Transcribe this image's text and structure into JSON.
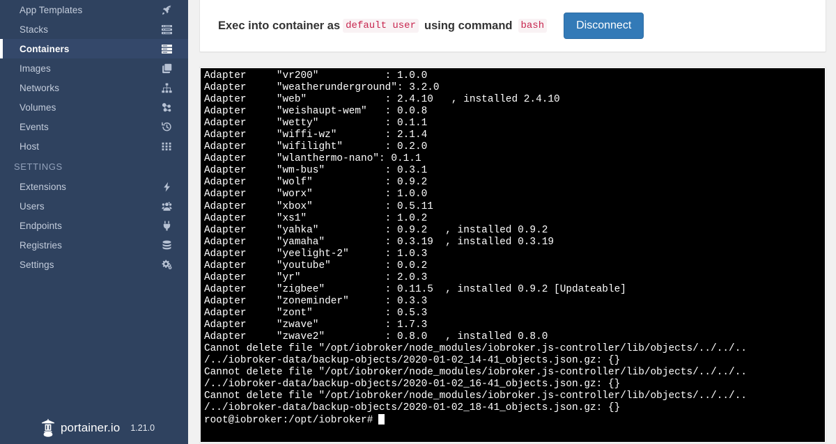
{
  "sidebar": {
    "items": [
      {
        "label": "App Templates",
        "icon": "rocket-icon",
        "active": false,
        "key": "app-templates"
      },
      {
        "label": "Stacks",
        "icon": "stacks-icon",
        "active": false,
        "key": "stacks"
      },
      {
        "label": "Containers",
        "icon": "containers-icon",
        "active": true,
        "key": "containers"
      },
      {
        "label": "Images",
        "icon": "images-icon",
        "active": false,
        "key": "images"
      },
      {
        "label": "Networks",
        "icon": "networks-icon",
        "active": false,
        "key": "networks"
      },
      {
        "label": "Volumes",
        "icon": "volumes-icon",
        "active": false,
        "key": "volumes"
      },
      {
        "label": "Events",
        "icon": "history-icon",
        "active": false,
        "key": "events"
      },
      {
        "label": "Host",
        "icon": "grid-icon",
        "active": false,
        "key": "host"
      }
    ],
    "section_label": "SETTINGS",
    "settings_items": [
      {
        "label": "Extensions",
        "icon": "bolt-icon",
        "active": false,
        "key": "extensions"
      },
      {
        "label": "Users",
        "icon": "users-icon",
        "active": false,
        "key": "users"
      },
      {
        "label": "Endpoints",
        "icon": "plug-icon",
        "active": false,
        "key": "endpoints"
      },
      {
        "label": "Registries",
        "icon": "database-icon",
        "active": false,
        "key": "registries"
      },
      {
        "label": "Settings",
        "icon": "gears-icon",
        "active": false,
        "key": "settings"
      }
    ],
    "footer": {
      "logo": "portainer-lighthouse-logo",
      "brand": "portainer.io",
      "version": "1.21.0"
    },
    "colors": {
      "background": "#2f425f",
      "active_background": "#34486a",
      "accent_bar": "#ffffff"
    }
  },
  "header": {
    "prefix": "Exec into container as",
    "user_code": "default user",
    "middle": "using command",
    "command_code": "bash",
    "disconnect_label": "Disconnect",
    "button_color": "#337ab7",
    "code_color": "#c7254e"
  },
  "terminal": {
    "background": "#000000",
    "foreground": "#ffffff",
    "prompt": "root@iobroker:/opt/iobroker#",
    "lines": [
      "Adapter     \"vr200\"           : 1.0.0",
      "Adapter     \"weatherunderground\": 3.2.0",
      "Adapter     \"web\"             : 2.4.10   , installed 2.4.10",
      "Adapter     \"weishaupt-wem\"   : 0.0.8",
      "Adapter     \"wetty\"           : 0.1.1",
      "Adapter     \"wiffi-wz\"        : 2.1.4",
      "Adapter     \"wifilight\"       : 0.2.0",
      "Adapter     \"wlanthermo-nano\": 0.1.1",
      "Adapter     \"wm-bus\"          : 0.3.1",
      "Adapter     \"wolf\"            : 0.9.2",
      "Adapter     \"worx\"            : 1.0.0",
      "Adapter     \"xbox\"            : 0.5.11",
      "Adapter     \"xs1\"             : 1.0.2",
      "Adapter     \"yahka\"           : 0.9.2   , installed 0.9.2",
      "Adapter     \"yamaha\"          : 0.3.19  , installed 0.3.19",
      "Adapter     \"yeelight-2\"      : 1.0.3",
      "Adapter     \"youtube\"         : 0.0.2",
      "Adapter     \"yr\"              : 2.0.3",
      "Adapter     \"zigbee\"          : 0.11.5  , installed 0.9.2 [Updateable]",
      "Adapter     \"zoneminder\"      : 0.3.3",
      "Adapter     \"zont\"            : 0.5.3",
      "Adapter     \"zwave\"           : 1.7.3",
      "Adapter     \"zwave2\"          : 0.8.0   , installed 0.8.0",
      "Cannot delete file \"/opt/iobroker/node_modules/iobroker.js-controller/lib/objects/../../..",
      "/../iobroker-data/backup-objects/2020-01-02_14-41_objects.json.gz: {}",
      "Cannot delete file \"/opt/iobroker/node_modules/iobroker.js-controller/lib/objects/../../..",
      "/../iobroker-data/backup-objects/2020-01-02_16-41_objects.json.gz: {}",
      "Cannot delete file \"/opt/iobroker/node_modules/iobroker.js-controller/lib/objects/../../..",
      "/../iobroker-data/backup-objects/2020-01-02_18-41_objects.json.gz: {}"
    ]
  }
}
